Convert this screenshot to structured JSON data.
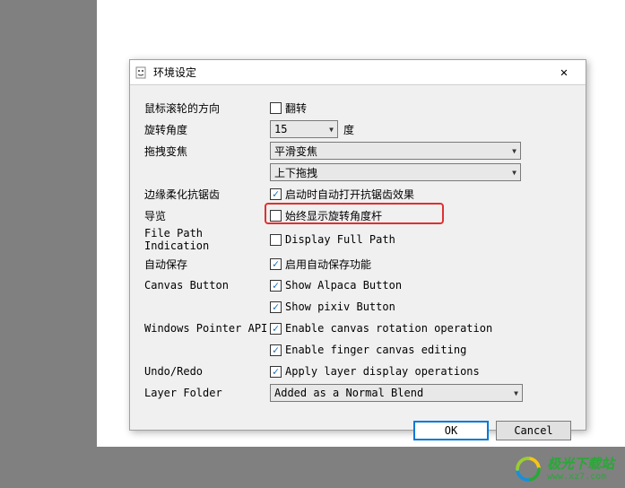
{
  "dialog": {
    "title": "环境设定",
    "close_label": "✕"
  },
  "rows": {
    "scroll_dir": {
      "label": "鼠标滚轮的方向",
      "checkbox": "翻转"
    },
    "rotation": {
      "label": "旋转角度",
      "value": "15",
      "unit": "度"
    },
    "drag_zoom": {
      "label": "拖拽变焦",
      "value1": "平滑变焦",
      "value2": "上下拖拽"
    },
    "antialias": {
      "label": "边缘柔化抗锯齿",
      "checkbox": "启动时自动打开抗锯齿效果"
    },
    "nav": {
      "label": "导览",
      "checkbox": "始终显示旋转角度杆"
    },
    "filepath": {
      "label": "File Path Indication",
      "checkbox": "Display Full Path"
    },
    "autosave": {
      "label": "自动保存",
      "checkbox": "启用自动保存功能"
    },
    "canvas_btn": {
      "label": "Canvas Button",
      "cb1": "Show Alpaca Button",
      "cb2": "Show pixiv Button"
    },
    "pointer": {
      "label": "Windows Pointer API",
      "cb1": "Enable canvas rotation operation",
      "cb2": "Enable finger canvas editing"
    },
    "undo": {
      "label": "Undo/Redo",
      "checkbox": "Apply layer display operations"
    },
    "layer_folder": {
      "label": "Layer Folder",
      "value": "Added as a Normal Blend"
    }
  },
  "buttons": {
    "ok": "OK",
    "cancel": "Cancel"
  },
  "watermark": {
    "cn": "极光下载站",
    "en": "www.xz7.com"
  }
}
